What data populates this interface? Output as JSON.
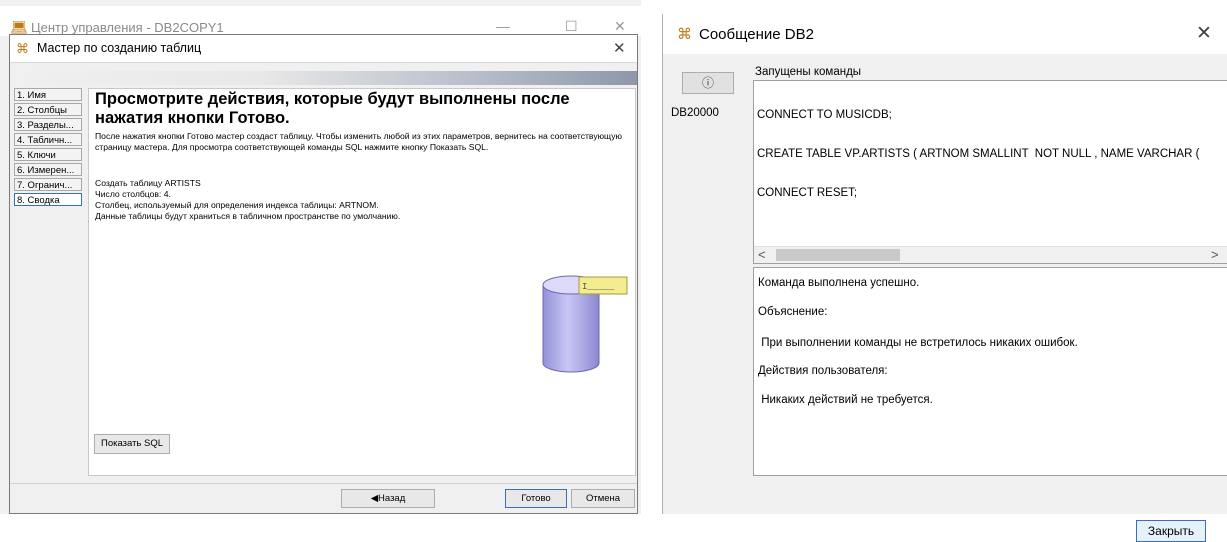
{
  "control_center": {
    "title": "Центр управления - DB2COPY1",
    "controls": {
      "minimize": "—",
      "maximize": "☐",
      "close": "✕"
    }
  },
  "wizard": {
    "title": "Мастер по созданию таблиц",
    "steps": [
      {
        "label": "1. Имя"
      },
      {
        "label": "2. Столбцы"
      },
      {
        "label": "3. Разделы..."
      },
      {
        "label": "4. Табличн..."
      },
      {
        "label": "5. Ключи"
      },
      {
        "label": "6. Измерен..."
      },
      {
        "label": "7. Огранич..."
      },
      {
        "label": "8. Сводка"
      }
    ],
    "active_step": 8,
    "heading": "Просмотрите действия, которые будут выполнены после нажатия кнопки Готово.",
    "description": "После нажатия кнопки Готово мастер создаст таблицу. Чтобы изменить любой из этих параметров, вернитесь на соответствующую страницу мастера. Для просмотра соответствующей команды SQL нажмите кнопку Показать SQL.",
    "summary": [
      "Создать таблицу ARTISTS",
      "Число столбцов: 4.",
      "Столбец, используемый для определения индекса таблицы: ARTNOM.",
      "Данные таблицы будут храниться в табличном пространстве по умолчанию."
    ],
    "show_sql_label": "Показать SQL",
    "back_label": "◀Назад",
    "done_label": "Готово",
    "cancel_label": "Отмена",
    "close_icon": "✕"
  },
  "db2_message": {
    "title": "Сообщение DB2",
    "close_icon": "✕",
    "info_icon": "ⓘ",
    "message_code": "DB20000",
    "commands_label": "Запущены команды",
    "commands": [
      "CONNECT TO MUSICDB;",
      "CREATE TABLE VP.ARTISTS ( ARTNOM SMALLINT  NOT NULL , NAME VARCHAR (",
      "CONNECT RESET;"
    ],
    "scroll_left": "<",
    "scroll_right": ">",
    "result_lines": [
      "Команда  выполнена успешно.",
      "Объяснение:",
      " При выполнении команды не встретилось никаких ошибок.",
      "Действия пользователя:",
      " Никаких действий не требуется."
    ],
    "close_button_label": "Закрыть"
  },
  "colors": {
    "accent": "#3a6fb8",
    "app_icon": "#c07a15",
    "cylinder": "#b7b5ec",
    "note": "#f4ec91"
  }
}
